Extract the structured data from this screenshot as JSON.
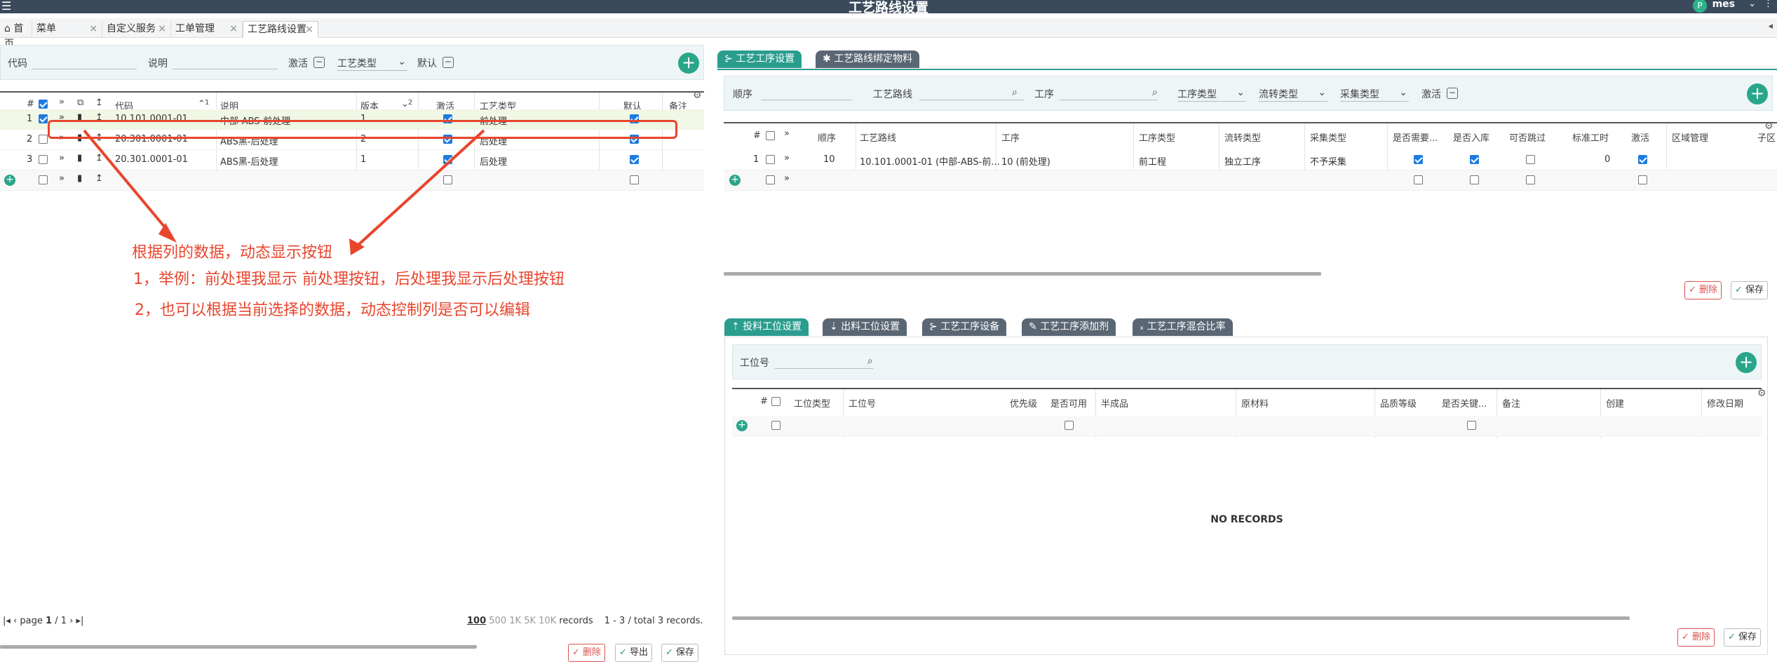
{
  "app": {
    "title": "工艺路线设置",
    "user": "mes",
    "avatar_letter": "P"
  },
  "tabs": [
    "首页",
    "菜单",
    "自定义服务",
    "工单管理",
    "工艺路线设置"
  ],
  "left": {
    "filter": {
      "code_label": "代码",
      "desc_label": "说明",
      "active_label": "激活",
      "type_select": "工艺类型",
      "default_label": "默认"
    },
    "headers": {
      "num": "#",
      "code": "代码",
      "sort1": "1",
      "desc": "说明",
      "version": "版本",
      "sort2": "2",
      "active": "激活",
      "type": "工艺类型",
      "default": "默认",
      "remark": "备注"
    },
    "rows": [
      {
        "num": "1",
        "code": "10.101.0001-01",
        "desc": "中部-ABS-前处理",
        "version": "1",
        "type": "前处理",
        "checked": true,
        "active": true,
        "default": true
      },
      {
        "num": "2",
        "code": "20.301.0001-01",
        "desc": "ABS黑-后处理",
        "version": "2",
        "type": "后处理",
        "checked": false,
        "active": true,
        "default": true
      },
      {
        "num": "3",
        "code": "20.301.0001-01",
        "desc": "ABS黑-后处理",
        "version": "1",
        "type": "后处理",
        "checked": false,
        "active": true,
        "default": true
      }
    ],
    "pager": {
      "page_label": "page",
      "page": "1",
      "of": "/",
      "total_pages": "1",
      "sizes": [
        "100",
        "500",
        "1K",
        "5K",
        "10K"
      ],
      "records_label": "records",
      "range": "1 - 3",
      "total": "total 3 records."
    },
    "buttons": {
      "delete": "删除",
      "export": "导出",
      "save": "保存"
    }
  },
  "annotation": {
    "line1": "根据列的数据，动态显示按钮",
    "line2": "1，举例：前处理我显示 前处理按钮，后处理我显示后处理按钮",
    "line3": "2，也可以根据当前选择的数据，动态控制列是否可以编辑"
  },
  "right_top": {
    "tabs": [
      "工艺工序设置",
      "工艺路线绑定物料"
    ],
    "filter": {
      "seq_label": "顺序",
      "route_label": "工艺路线",
      "process_label": "工序",
      "process_type": "工序类型",
      "flow_type": "流转类型",
      "collect_type": "采集类型",
      "active_label": "激活"
    },
    "headers": [
      "#",
      "顺序",
      "工艺路线",
      "工序",
      "工序类型",
      "流转类型",
      "采集类型",
      "是否需要...",
      "是否入库",
      "可否跳过",
      "标准工时",
      "激活",
      "区域管理",
      "子区"
    ],
    "rows": [
      {
        "num": "1",
        "seq": "10",
        "route": "10.101.0001-01 (中部-ABS-前...",
        "process": "10 (前处理)",
        "ptype": "前工程",
        "flow": "独立工序",
        "collect": "不予采集",
        "need": true,
        "stock": true,
        "skip": false,
        "std_time": "0",
        "active": true
      }
    ],
    "buttons": {
      "delete": "删除",
      "save": "保存"
    }
  },
  "right_bottom": {
    "tabs": [
      "投料工位设置",
      "出料工位设置",
      "工艺工序设备",
      "工艺工序添加剂",
      "工艺工序混合比率"
    ],
    "filter": {
      "station_label": "工位号"
    },
    "headers": [
      "#",
      "工位类型",
      "工位号",
      "优先级",
      "是否可用",
      "半成品",
      "原材料",
      "品质等级",
      "是否关键...",
      "备注",
      "创建",
      "修改日期"
    ],
    "empty": "NO RECORDS",
    "buttons": {
      "delete": "删除",
      "save": "保存"
    }
  },
  "colors": {
    "accent": "#2a9d8f",
    "annotation": "#e8452d",
    "checkbox": "#1e7be0"
  }
}
